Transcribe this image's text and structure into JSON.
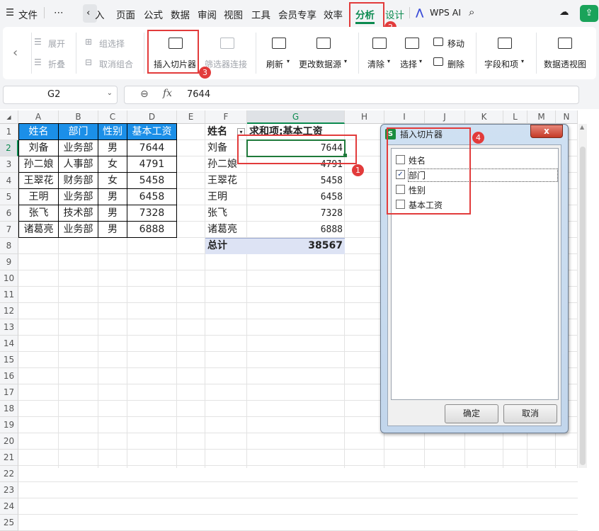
{
  "menu": {
    "file": "文件",
    "more": "⋯",
    "insert_partial": "入",
    "page": "页面",
    "formula": "公式",
    "data": "数据",
    "review": "审阅",
    "view": "视图",
    "tools": "工具",
    "member": "会员专享",
    "efficiency": "效率",
    "analyze": "分析",
    "design": "设计",
    "wps_ai": "WPS AI"
  },
  "ribbon": {
    "expand": "展开",
    "collapse": "折叠",
    "group_select": "组选择",
    "ungroup": "取消组合",
    "insert_slicer": "插入切片器",
    "filter_conn": "筛选器连接",
    "refresh": "刷新",
    "change_source": "更改数据源",
    "clear": "清除",
    "select": "选择",
    "move": "移动",
    "delete": "删除",
    "fields_items": "字段和项",
    "pivot_view": "数据透视图"
  },
  "formula_bar": {
    "cell_ref": "G2",
    "fx": "fx",
    "value": "7644"
  },
  "columns": [
    "A",
    "B",
    "C",
    "D",
    "E",
    "F",
    "G",
    "H",
    "I",
    "J",
    "K",
    "L",
    "M",
    "N"
  ],
  "rows": [
    "1",
    "2",
    "3",
    "4",
    "5",
    "6",
    "7",
    "8",
    "9",
    "10",
    "11",
    "12",
    "13",
    "14",
    "15",
    "16",
    "17",
    "18",
    "19",
    "20",
    "21",
    "22",
    "23",
    "24",
    "25"
  ],
  "source_table": {
    "headers": [
      "姓名",
      "部门",
      "性别",
      "基本工资"
    ],
    "rows": [
      [
        "刘备",
        "业务部",
        "男",
        "7644"
      ],
      [
        "孙二娘",
        "人事部",
        "女",
        "4791"
      ],
      [
        "王翠花",
        "财务部",
        "女",
        "5458"
      ],
      [
        "王明",
        "业务部",
        "男",
        "6458"
      ],
      [
        "张飞",
        "技术部",
        "男",
        "7328"
      ],
      [
        "诸葛亮",
        "业务部",
        "男",
        "6888"
      ]
    ]
  },
  "pivot": {
    "header_name": "姓名",
    "header_value": "求和项:基本工资",
    "rows": [
      [
        "刘备",
        "7644"
      ],
      [
        "孙二娘",
        "4791"
      ],
      [
        "王翠花",
        "5458"
      ],
      [
        "王明",
        "6458"
      ],
      [
        "张飞",
        "7328"
      ],
      [
        "诸葛亮",
        "6888"
      ]
    ],
    "total_label": "总计",
    "total_value": "38567"
  },
  "dialog": {
    "icon": "S",
    "title": "插入切片器",
    "close": "x",
    "fields": [
      {
        "label": "姓名",
        "checked": false
      },
      {
        "label": "部门",
        "checked": true
      },
      {
        "label": "性别",
        "checked": false
      },
      {
        "label": "基本工资",
        "checked": false
      }
    ],
    "ok": "确定",
    "cancel": "取消"
  },
  "badges": {
    "b1": "1",
    "b2": "2",
    "b3": "3",
    "b4": "4"
  },
  "colors": {
    "accent_green": "#0b8a4f",
    "header_blue": "#1b8fe8",
    "annotation_red": "#e23b3b",
    "pivot_total_bg": "#dde3f4"
  }
}
